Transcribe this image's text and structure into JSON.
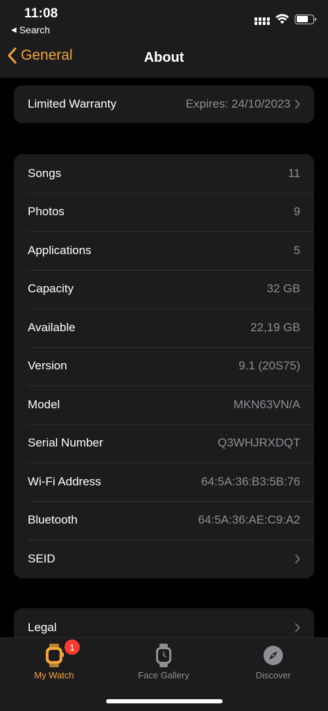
{
  "status_bar": {
    "time": "11:08",
    "back_app": "Search"
  },
  "nav": {
    "back_label": "General",
    "title": "About"
  },
  "warranty": {
    "label": "Limited Warranty",
    "value": "Expires: 24/10/2023"
  },
  "info_rows": [
    {
      "label": "Songs",
      "value": "11"
    },
    {
      "label": "Photos",
      "value": "9"
    },
    {
      "label": "Applications",
      "value": "5"
    },
    {
      "label": "Capacity",
      "value": "32 GB"
    },
    {
      "label": "Available",
      "value": "22,19 GB"
    },
    {
      "label": "Version",
      "value": "9.1 (20S75)"
    },
    {
      "label": "Model",
      "value": "MKN63VN/A"
    },
    {
      "label": "Serial Number",
      "value": "Q3WHJRXDQT"
    },
    {
      "label": "Wi-Fi Address",
      "value": "64:5A:36:B3:5B:76"
    },
    {
      "label": "Bluetooth",
      "value": "64:5A:36:AE:C9:A2"
    }
  ],
  "seid": {
    "label": "SEID"
  },
  "legal": {
    "label": "Legal"
  },
  "tabs": {
    "my_watch": {
      "label": "My Watch",
      "badge": "1"
    },
    "face_gallery": {
      "label": "Face Gallery"
    },
    "discover": {
      "label": "Discover"
    }
  },
  "colors": {
    "accent": "#f2a33a",
    "background": "#000000",
    "cell": "#1c1c1e",
    "secondary_text": "#8e8e93",
    "badge": "#ff3b30"
  }
}
